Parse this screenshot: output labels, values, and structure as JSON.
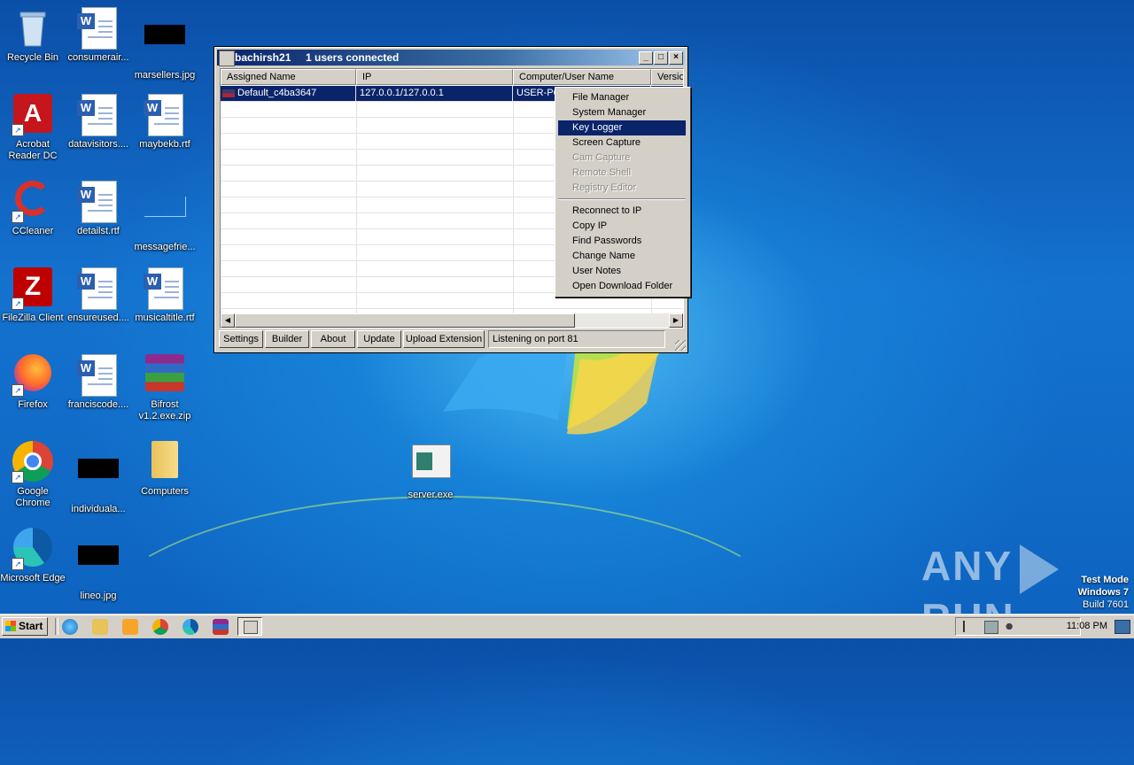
{
  "desktop": {
    "icons": [
      {
        "label": "Recycle Bin",
        "icon": "recycle-bin-icon"
      },
      {
        "label": "consumerair...",
        "icon": "word-doc-icon"
      },
      {
        "label": "marsellers.jpg",
        "icon": "image-file-icon"
      },
      {
        "label": "Acrobat Reader DC",
        "icon": "acrobat-icon"
      },
      {
        "label": "datavisitors....",
        "icon": "word-doc-icon"
      },
      {
        "label": "maybekb.rtf",
        "icon": "word-doc-icon"
      },
      {
        "label": "CCleaner",
        "icon": "ccleaner-icon"
      },
      {
        "label": "detailst.rtf",
        "icon": "word-doc-icon"
      },
      {
        "label": "messagefrie...",
        "icon": "file-icon"
      },
      {
        "label": "FileZilla Client",
        "icon": "filezilla-icon"
      },
      {
        "label": "ensureused....",
        "icon": "word-doc-icon"
      },
      {
        "label": "musicaltitle.rtf",
        "icon": "word-doc-icon"
      },
      {
        "label": "Firefox",
        "icon": "firefox-icon"
      },
      {
        "label": "franciscode....",
        "icon": "word-doc-icon"
      },
      {
        "label": "Bifrost v1.2.exe.zip",
        "icon": "winrar-archive-icon"
      },
      {
        "label": "Google Chrome",
        "icon": "chrome-icon"
      },
      {
        "label": "individuala...",
        "icon": "image-file-icon"
      },
      {
        "label": "Computers",
        "icon": "folder-icon"
      },
      {
        "label": "server.exe",
        "icon": "exe-icon"
      },
      {
        "label": "Microsoft Edge",
        "icon": "edge-icon"
      },
      {
        "label": "lineo.jpg",
        "icon": "image-file-icon"
      }
    ]
  },
  "window": {
    "title": "bachirsh21",
    "users_connected": "1 users connected",
    "columns": [
      "Assigned Name",
      "IP",
      "Computer/User Name",
      "Versio"
    ],
    "rows": [
      {
        "name": "Default_c4ba3647",
        "ip": "127.0.0.1/127.0.0.1",
        "computer": "USER-PC"
      }
    ],
    "buttons": {
      "settings": "Settings",
      "builder": "Builder",
      "about": "About",
      "update": "Update",
      "upload_extension": "Upload Extension"
    },
    "status": "Listening on port 81"
  },
  "context_menu": {
    "items": [
      {
        "label": "File Manager",
        "enabled": true
      },
      {
        "label": "System Manager",
        "enabled": true
      },
      {
        "label": "Key Logger",
        "enabled": true,
        "highlighted": true
      },
      {
        "label": "Screen Capture",
        "enabled": true
      },
      {
        "label": "Cam Capture",
        "enabled": false
      },
      {
        "label": "Remote Shell",
        "enabled": false
      },
      {
        "label": "Registry Editor",
        "enabled": false
      },
      {
        "label": "Reconnect to IP",
        "enabled": true
      },
      {
        "label": "Copy IP",
        "enabled": true
      },
      {
        "label": "Find Passwords",
        "enabled": true
      },
      {
        "label": "Change Name",
        "enabled": true
      },
      {
        "label": "User Notes",
        "enabled": true
      },
      {
        "label": "Open Download Folder",
        "enabled": true
      }
    ]
  },
  "watermark": {
    "brand_left": "ANY",
    "brand_right": "RUN",
    "test_mode": "Test Mode",
    "os": "Windows 7",
    "build": "Build 7601"
  },
  "taskbar": {
    "start_label": "Start",
    "clock": "11:08 PM"
  },
  "colors": {
    "selection": "#0a246a",
    "title_start": "#0a246a",
    "title_end": "#a6caf0",
    "face": "#d4d0c8",
    "desktop_blue": "#1472cf"
  }
}
